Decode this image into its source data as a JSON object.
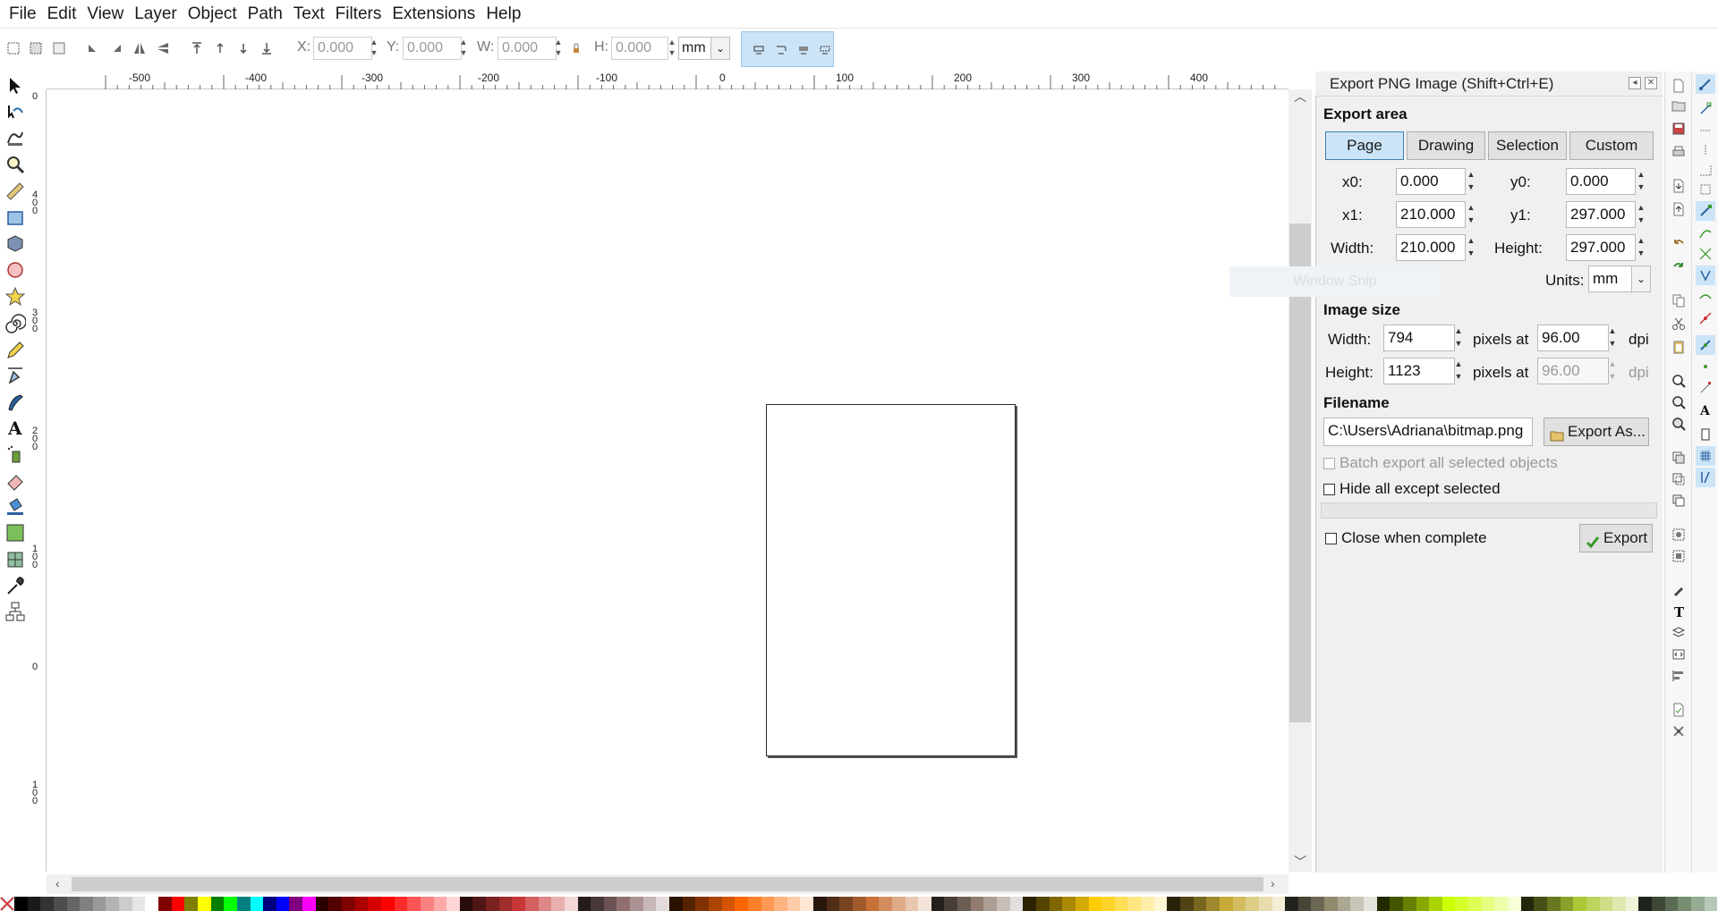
{
  "menu": [
    "File",
    "Edit",
    "View",
    "Layer",
    "Object",
    "Path",
    "Text",
    "Filters",
    "Extensions",
    "Help"
  ],
  "toolbar": {
    "x_label": "X:",
    "x_value": "0.000",
    "y_label": "Y:",
    "y_value": "0.000",
    "w_label": "W:",
    "w_value": "0.000",
    "h_label": "H:",
    "h_value": "0.000",
    "unit": "mm"
  },
  "ruler": {
    "h_ticks": [
      "-500",
      "-400",
      "-300",
      "-200",
      "-100",
      "0",
      "100",
      "200",
      "300",
      "400"
    ],
    "v_ticks": [
      "0",
      "400",
      "300",
      "200",
      "100",
      "0",
      "100"
    ]
  },
  "dialog": {
    "title": "Export PNG Image (Shift+Ctrl+E)",
    "export_area": {
      "heading": "Export area",
      "modes": [
        "Page",
        "Drawing",
        "Selection",
        "Custom"
      ],
      "active_mode": "Page",
      "x0_label": "x0:",
      "x0": "0.000",
      "y0_label": "y0:",
      "y0": "0.000",
      "x1_label": "x1:",
      "x1": "210.000",
      "y1_label": "y1:",
      "y1": "297.000",
      "width_label": "Width:",
      "width": "210.000",
      "height_label": "Height:",
      "height": "297.000",
      "units_label": "Units:",
      "units": "mm"
    },
    "image_size": {
      "heading": "Image size",
      "width_label": "Width:",
      "width_px": "794",
      "pixels_at": "pixels at",
      "dpi_x": "96.00",
      "dpi_label": "dpi",
      "height_label": "Height:",
      "height_px": "1123",
      "dpi_y": "96.00"
    },
    "filename": {
      "heading": "Filename",
      "path": "C:\\Users\\Adriana\\bitmap.png",
      "export_as": "Export As..."
    },
    "batch_export": "Batch export all selected objects",
    "hide_except": "Hide all except selected",
    "close_when_complete": "Close when complete",
    "export_button": "Export"
  },
  "overlay_snip": "Window Snip",
  "colors": {
    "accent": "#cce4f7",
    "accent_border": "#3c7fb1",
    "palette": [
      "#000000",
      "#1a1a1a",
      "#333333",
      "#4d4d4d",
      "#666666",
      "#808080",
      "#999999",
      "#b3b3b3",
      "#cccccc",
      "#e6e6e6",
      "#ffffff",
      "#800000",
      "#ff0000",
      "#808000",
      "#ffff00",
      "#008000",
      "#00ff00",
      "#008080",
      "#00ffff",
      "#000080",
      "#0000ff",
      "#800080",
      "#ff00ff",
      "#2b0000",
      "#550000",
      "#800000",
      "#aa0000",
      "#d40000",
      "#ff0000",
      "#ff2a2a",
      "#ff5555",
      "#ff8080",
      "#ffaaaa",
      "#ffd5d5",
      "#280b0b",
      "#501616",
      "#782121",
      "#a02c2c",
      "#c83737",
      "#d35f5f",
      "#de8787",
      "#e9afaf",
      "#f4d7d7",
      "#241c1c",
      "#483737",
      "#6c5353",
      "#916f6f",
      "#ac9393",
      "#c8b7b7",
      "#e3dbdb",
      "#2b1100",
      "#552200",
      "#803300",
      "#aa4400",
      "#d45500",
      "#ff6600",
      "#ff7f2a",
      "#ff9955",
      "#ffb380",
      "#ffccaa",
      "#ffe6d5",
      "#28170b",
      "#502d16",
      "#784421",
      "#a05a2c",
      "#c87137",
      "#d38d5f",
      "#deaa87",
      "#e9c6af",
      "#f4e3d7",
      "#241f1c",
      "#483e37",
      "#6c5d53",
      "#917c6f",
      "#ac9d93",
      "#c8beb7",
      "#e3dedb",
      "#2b2200",
      "#554400",
      "#806600",
      "#aa8800",
      "#d4aa00",
      "#ffcc00",
      "#ffd42a",
      "#ffdd55",
      "#ffe680",
      "#ffeeaa",
      "#fff6d5",
      "#28220b",
      "#504416",
      "#786721",
      "#a0892c",
      "#c8ab37",
      "#d3bc5f",
      "#decd87",
      "#e9ddaf",
      "#f4eed7",
      "#24221c",
      "#484537",
      "#6c6753",
      "#918a6f",
      "#aca793",
      "#c8c4b7",
      "#e3e2db",
      "#222b00",
      "#445500",
      "#668000",
      "#88aa00",
      "#aad400",
      "#ccff00",
      "#d4ff2a",
      "#ddff55",
      "#e5ff80",
      "#eeffaa",
      "#f6ffd5",
      "#22280b",
      "#445016",
      "#677821",
      "#89a02c",
      "#abc837",
      "#bcd35f",
      "#cdde87",
      "#dde9af",
      "#eef4d7",
      "#1f241c",
      "#3e4837",
      "#5a6c53",
      "#768e6f",
      "#95ac93",
      "#b7c8b7"
    ]
  }
}
